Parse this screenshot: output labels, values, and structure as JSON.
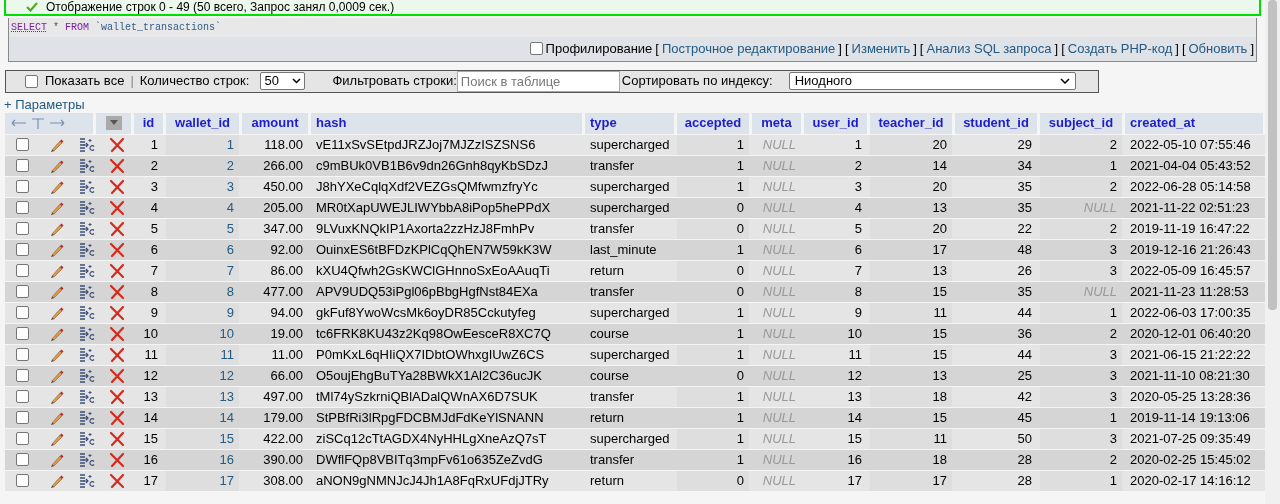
{
  "message": {
    "text": "Отображение строк 0 - 49 (50 всего, Запрос занял 0,0009 сек.)"
  },
  "sql": {
    "keyword_select": "SELECT",
    "star": "*",
    "keyword_from": "FROM",
    "table": "`wallet_transactions`"
  },
  "sql_actions": {
    "profiling": {
      "label": "Профилирование",
      "checked": false
    },
    "links": [
      {
        "before": "[",
        "label": "Построчное редактирование",
        "after": "]"
      },
      {
        "before": "[",
        "label": "Изменить",
        "after": "]"
      },
      {
        "before": "[",
        "label": "Анализ SQL запроса",
        "after": "]"
      },
      {
        "before": "[",
        "label": "Создать PHP-код",
        "after": "]"
      },
      {
        "before": "[",
        "label": "Обновить",
        "after": "]"
      }
    ]
  },
  "toolbar": {
    "show_all": {
      "label": "Показать все",
      "checked": false
    },
    "separator": "|",
    "rows_label": "Количество строк:",
    "rows_value": "50",
    "filter_label": "Фильтровать строки:",
    "filter_placeholder": "Поиск в таблице",
    "sort_label": "Сортировать по индексу:",
    "sort_value": "Ниодного"
  },
  "options_link": "+ Параметры",
  "table": {
    "columns": [
      {
        "label": "id",
        "kind": "number"
      },
      {
        "label": "wallet_id",
        "kind": "link"
      },
      {
        "label": "amount",
        "kind": "number"
      },
      {
        "label": "hash",
        "kind": "text"
      },
      {
        "label": "type",
        "kind": "text"
      },
      {
        "label": "accepted",
        "kind": "number"
      },
      {
        "label": "meta",
        "kind": "number"
      },
      {
        "label": "user_id",
        "kind": "number"
      },
      {
        "label": "teacher_id",
        "kind": "number"
      },
      {
        "label": "student_id",
        "kind": "number"
      },
      {
        "label": "subject_id",
        "kind": "number"
      },
      {
        "label": "created_at",
        "kind": "text"
      }
    ],
    "rows": [
      {
        "checked": false,
        "cells": [
          "1",
          "1",
          "118.00",
          "vE11xSvSEtpdJRZJoj7MJZzISZSNS6",
          "supercharged",
          "1",
          {
            "text": "NULL",
            "null": true
          },
          "1",
          "20",
          "29",
          "2",
          "2022-05-10 07:55:46"
        ]
      },
      {
        "checked": false,
        "cells": [
          "2",
          "2",
          "266.00",
          "c9mBUk0VB1B6v9dn26Gnh8qyKbSDzJ",
          "transfer",
          "1",
          {
            "text": "NULL",
            "null": true
          },
          "2",
          "14",
          "34",
          "1",
          "2021-04-04 05:43:52"
        ]
      },
      {
        "checked": false,
        "cells": [
          "3",
          "3",
          "450.00",
          "J8hYXeCqlqXdf2VEZGsQMfwmzfryYc",
          "supercharged",
          "1",
          {
            "text": "NULL",
            "null": true
          },
          "3",
          "20",
          "35",
          "2",
          "2022-06-28 05:14:58"
        ]
      },
      {
        "checked": false,
        "cells": [
          "4",
          "4",
          "205.00",
          "MR0tXapUWEJLIWYbbA8iPop5hePPdX",
          "supercharged",
          "0",
          {
            "text": "NULL",
            "null": true
          },
          "4",
          "13",
          "35",
          {
            "text": "NULL",
            "null": true
          },
          "2021-11-22 02:51:23"
        ]
      },
      {
        "checked": false,
        "cells": [
          "5",
          "5",
          "347.00",
          "9LVuxKNQkIP1Axorta2zzHzJ8FmhPv",
          "transfer",
          "0",
          {
            "text": "NULL",
            "null": true
          },
          "5",
          "20",
          "22",
          "2",
          "2019-11-19 16:47:22"
        ]
      },
      {
        "checked": false,
        "cells": [
          "6",
          "6",
          "92.00",
          "OuinxES6tBFDzKPlCqQhEN7W59kK3W",
          "last_minute",
          "1",
          {
            "text": "NULL",
            "null": true
          },
          "6",
          "17",
          "48",
          "3",
          "2019-12-16 21:26:43"
        ]
      },
      {
        "checked": false,
        "cells": [
          "7",
          "7",
          "86.00",
          "kXU4Qfwh2GsKWClGHnnoSxEoAAuqTi",
          "return",
          "0",
          {
            "text": "NULL",
            "null": true
          },
          "7",
          "13",
          "26",
          "3",
          "2022-05-09 16:45:57"
        ]
      },
      {
        "checked": false,
        "cells": [
          "8",
          "8",
          "477.00",
          "APV9UDQ53iPgl06pBbgHgfNst84EXa",
          "transfer",
          "0",
          {
            "text": "NULL",
            "null": true
          },
          "8",
          "15",
          "35",
          {
            "text": "NULL",
            "null": true
          },
          "2021-11-23 11:28:53"
        ]
      },
      {
        "checked": false,
        "cells": [
          "9",
          "9",
          "94.00",
          "gkFuf8YwoWcsMk6oyDR85Cckutyfeg",
          "supercharged",
          "1",
          {
            "text": "NULL",
            "null": true
          },
          "9",
          "11",
          "44",
          "1",
          "2022-06-03 17:00:35"
        ]
      },
      {
        "checked": false,
        "cells": [
          "10",
          "10",
          "19.00",
          "tc6FRK8KU43z2Kq98OwEesceR8XC7Q",
          "course",
          "1",
          {
            "text": "NULL",
            "null": true
          },
          "10",
          "15",
          "36",
          "2",
          "2020-12-01 06:40:20"
        ]
      },
      {
        "checked": false,
        "cells": [
          "11",
          "11",
          "11.00",
          "P0mKxL6qHIiQX7IDbtOWhxgIUwZ6CS",
          "supercharged",
          "1",
          {
            "text": "NULL",
            "null": true
          },
          "11",
          "15",
          "44",
          "3",
          "2021-06-15 21:22:22"
        ]
      },
      {
        "checked": false,
        "cells": [
          "12",
          "12",
          "66.00",
          "O5oujEhgBuTYa28BWkX1Al2C36ucJK",
          "course",
          "0",
          {
            "text": "NULL",
            "null": true
          },
          "12",
          "13",
          "25",
          "3",
          "2021-11-10 08:21:30"
        ]
      },
      {
        "checked": false,
        "cells": [
          "13",
          "13",
          "497.00",
          "tMl74ySzkrniQBlADalQWnAX6D7SUK",
          "transfer",
          "1",
          {
            "text": "NULL",
            "null": true
          },
          "13",
          "18",
          "42",
          "3",
          "2020-05-25 13:28:36"
        ]
      },
      {
        "checked": false,
        "cells": [
          "14",
          "14",
          "179.00",
          "StPBfRi3lRpgFDCBMJdFdKeYlSNANN",
          "return",
          "1",
          {
            "text": "NULL",
            "null": true
          },
          "14",
          "15",
          "45",
          "1",
          "2019-11-14 19:13:06"
        ]
      },
      {
        "checked": false,
        "cells": [
          "15",
          "15",
          "422.00",
          "ziSCq12cTtAGDX4NyHHLgXneAzQ7sT",
          "supercharged",
          "1",
          {
            "text": "NULL",
            "null": true
          },
          "15",
          "11",
          "50",
          "3",
          "2021-07-25 09:35:49"
        ]
      },
      {
        "checked": false,
        "cells": [
          "16",
          "16",
          "390.00",
          "DWflFQp8VBITq3mpFv61o635ZeZvdG",
          "transfer",
          "1",
          {
            "text": "NULL",
            "null": true
          },
          "16",
          "18",
          "28",
          "2",
          "2020-02-25 15:45:02"
        ]
      },
      {
        "checked": false,
        "cells": [
          "17",
          "17",
          "308.00",
          "aNON9gNMNJcJ4Jh1A8FqRxUFdjJTRy",
          "return",
          "0",
          {
            "text": "NULL",
            "null": true
          },
          "17",
          "17",
          "28",
          "1",
          "2020-02-17 14:16:12"
        ]
      }
    ]
  }
}
